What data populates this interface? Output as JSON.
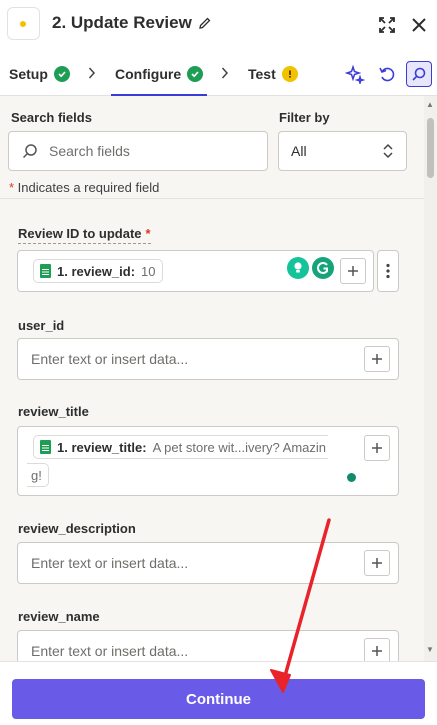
{
  "header": {
    "step_title": "2. Update Review",
    "icons": [
      "pencil-icon",
      "expand-icon",
      "close-icon"
    ]
  },
  "tabs": [
    {
      "label": "Setup",
      "status": "complete"
    },
    {
      "label": "Configure",
      "status": "complete"
    },
    {
      "label": "Test",
      "status": "warning"
    }
  ],
  "colors": {
    "accent": "#695be8",
    "success": "#1e9e55",
    "warning": "#f2c200",
    "required": "#d93a1a",
    "annotation": "#e8232a"
  },
  "search": {
    "label": "Search fields",
    "placeholder": "Search fields"
  },
  "filter": {
    "label": "Filter by",
    "value": "All"
  },
  "required_note": {
    "star": "*",
    "text": " Indicates a required field"
  },
  "fields": [
    {
      "label": "Review ID to update",
      "required": true,
      "pill_key": "1. review_id:",
      "pill_value": "10"
    },
    {
      "label": "user_id",
      "placeholder": "Enter text or insert data..."
    },
    {
      "label": "review_title",
      "pill_key": "1. review_title:",
      "pill_value": "A pet store wit...ivery? Amazin",
      "wrap_text": "g!"
    },
    {
      "label": "review_description",
      "placeholder": "Enter text or insert data..."
    },
    {
      "label": "review_name",
      "placeholder": "Enter text or insert data..."
    }
  ],
  "footer": {
    "continue_label": "Continue"
  }
}
